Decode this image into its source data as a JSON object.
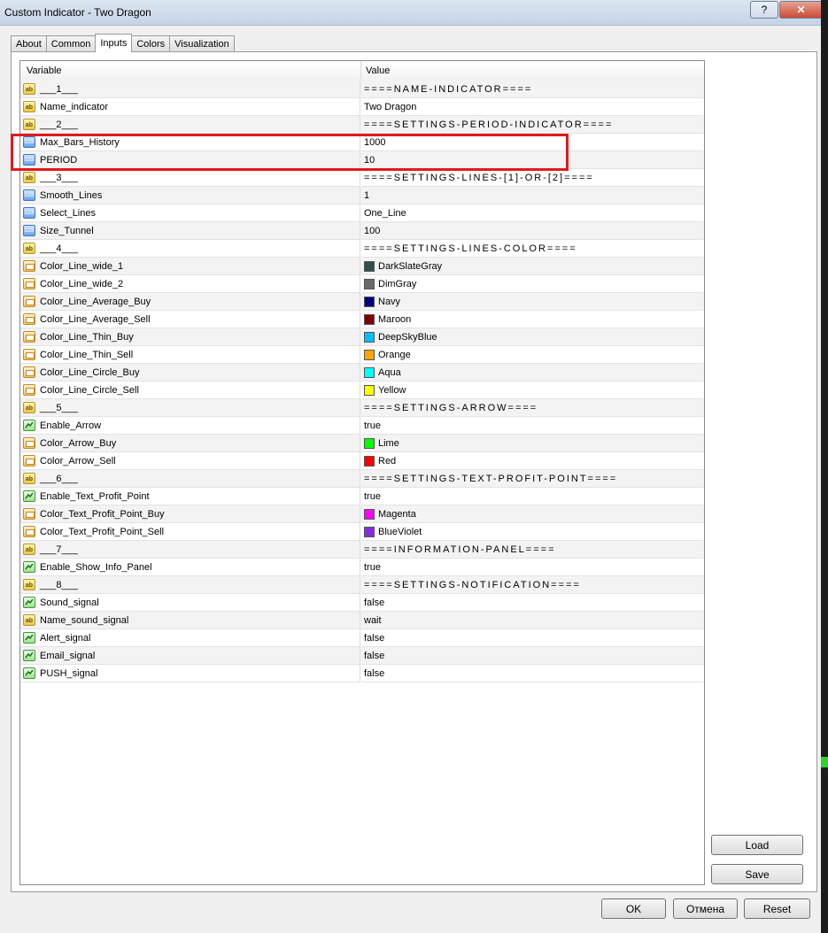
{
  "window": {
    "title": "Custom Indicator - Two Dragon",
    "help_label": "?",
    "close_label": "✕"
  },
  "tabs": [
    {
      "label": "About"
    },
    {
      "label": "Common"
    },
    {
      "label": "Inputs"
    },
    {
      "label": "Colors"
    },
    {
      "label": "Visualization"
    }
  ],
  "grid": {
    "headers": {
      "variable": "Variable",
      "value": "Value"
    },
    "rows": [
      {
        "icon": "ab",
        "variable": "___1___",
        "value": "====NAME-INDICATOR====",
        "kind": "sep"
      },
      {
        "icon": "ab",
        "variable": "Name_indicator",
        "value": "Two Dragon"
      },
      {
        "icon": "ab",
        "variable": "___2___",
        "value": "====SETTINGS-PERIOD-INDICATOR====",
        "kind": "sep"
      },
      {
        "icon": "num",
        "variable": "Max_Bars_History",
        "value": "1000"
      },
      {
        "icon": "num",
        "variable": "PERIOD",
        "value": "10"
      },
      {
        "icon": "ab",
        "variable": "___3___",
        "value": "====SETTINGS-LINES-[1]-OR-[2]====",
        "kind": "sep"
      },
      {
        "icon": "num",
        "variable": "Smooth_Lines",
        "value": "1"
      },
      {
        "icon": "num",
        "variable": "Select_Lines",
        "value": "One_Line"
      },
      {
        "icon": "num",
        "variable": "Size_Tunnel",
        "value": "100"
      },
      {
        "icon": "ab",
        "variable": "___4___",
        "value": "====SETTINGS-LINES-COLOR====",
        "kind": "sep"
      },
      {
        "icon": "color",
        "variable": "Color_Line_wide_1",
        "value": "DarkSlateGray",
        "swatch": "#2f4f4f"
      },
      {
        "icon": "color",
        "variable": "Color_Line_wide_2",
        "value": "DimGray",
        "swatch": "#696969"
      },
      {
        "icon": "color",
        "variable": "Color_Line_Average_Buy",
        "value": "Navy",
        "swatch": "#000080"
      },
      {
        "icon": "color",
        "variable": "Color_Line_Average_Sell",
        "value": "Maroon",
        "swatch": "#800000"
      },
      {
        "icon": "color",
        "variable": "Color_Line_Thin_Buy",
        "value": "DeepSkyBlue",
        "swatch": "#00bfff"
      },
      {
        "icon": "color",
        "variable": "Color_Line_Thin_Sell",
        "value": "Orange",
        "swatch": "#ffa500"
      },
      {
        "icon": "color",
        "variable": "Color_Line_Circle_Buy",
        "value": "Aqua",
        "swatch": "#00ffff"
      },
      {
        "icon": "color",
        "variable": "Color_Line_Circle_Sell",
        "value": "Yellow",
        "swatch": "#ffff00"
      },
      {
        "icon": "ab",
        "variable": "___5___",
        "value": "====SETTINGS-ARROW====",
        "kind": "sep"
      },
      {
        "icon": "bool",
        "variable": "Enable_Arrow",
        "value": "true"
      },
      {
        "icon": "color",
        "variable": "Color_Arrow_Buy",
        "value": "Lime",
        "swatch": "#00ff00"
      },
      {
        "icon": "color",
        "variable": "Color_Arrow_Sell",
        "value": "Red",
        "swatch": "#ff0000"
      },
      {
        "icon": "ab",
        "variable": "___6___",
        "value": "====SETTINGS-TEXT-PROFIT-POINT====",
        "kind": "sep"
      },
      {
        "icon": "bool",
        "variable": "Enable_Text_Profit_Point",
        "value": "true"
      },
      {
        "icon": "color",
        "variable": "Color_Text_Profit_Point_Buy",
        "value": "Magenta",
        "swatch": "#ff00ff"
      },
      {
        "icon": "color",
        "variable": "Color_Text_Profit_Point_Sell",
        "value": "BlueViolet",
        "swatch": "#8a2be2"
      },
      {
        "icon": "ab",
        "variable": "___7___",
        "value": "====INFORMATION-PANEL====",
        "kind": "sep"
      },
      {
        "icon": "bool",
        "variable": "Enable_Show_Info_Panel",
        "value": "true"
      },
      {
        "icon": "ab",
        "variable": "___8___",
        "value": "====SETTINGS-NOTIFICATION====",
        "kind": "sep"
      },
      {
        "icon": "bool",
        "variable": "Sound_signal",
        "value": "false"
      },
      {
        "icon": "ab",
        "variable": "Name_sound_signal",
        "value": "wait"
      },
      {
        "icon": "bool",
        "variable": "Alert_signal",
        "value": "false"
      },
      {
        "icon": "bool",
        "variable": "Email_signal",
        "value": "false"
      },
      {
        "icon": "bool",
        "variable": "PUSH_signal",
        "value": "false"
      }
    ]
  },
  "side_buttons": {
    "load": "Load",
    "save": "Save"
  },
  "bottom_buttons": {
    "ok": "OK",
    "cancel": "Отмена",
    "reset": "Reset"
  },
  "icon_labels": {
    "ab": "ab",
    "num": "123"
  },
  "colors": {
    "highlight": "#e01b1b"
  }
}
